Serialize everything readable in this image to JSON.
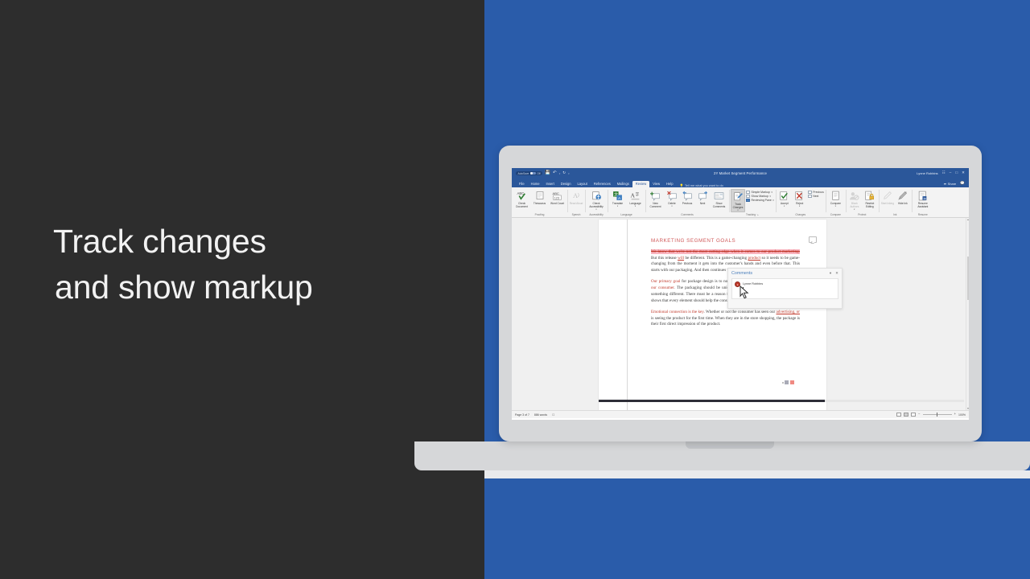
{
  "headline": {
    "line1": "Track changes",
    "line2": "and show markup"
  },
  "colors": {
    "background_left": "#2d2d2d",
    "background_right": "#2a5caa",
    "word_accent": "#2b579a",
    "heading_red": "#d05a5a",
    "markup_red": "#c0392b",
    "deletion_highlight": "#f9b5c0"
  },
  "word": {
    "titlebar": {
      "autosave_label": "AutoSave",
      "autosave_state": "Off",
      "save_icon": "save-icon",
      "undo_icon": "undo-icon",
      "redo_icon": "redo-icon",
      "customize_icon": "customize-quick-access-icon",
      "document_title": "2Y Market Segment Performance",
      "user_name": "Lynne Robbins",
      "ribbon_display_icon": "ribbon-display-options-icon",
      "minimize": "–",
      "maximize": "□",
      "close": "✕"
    },
    "tabs": [
      {
        "label": "File",
        "active": false
      },
      {
        "label": "Home",
        "active": false
      },
      {
        "label": "Insert",
        "active": false
      },
      {
        "label": "Design",
        "active": false
      },
      {
        "label": "Layout",
        "active": false
      },
      {
        "label": "References",
        "active": false
      },
      {
        "label": "Mailings",
        "active": false
      },
      {
        "label": "Review",
        "active": true
      },
      {
        "label": "View",
        "active": false
      },
      {
        "label": "Help",
        "active": false
      }
    ],
    "tellme": "Tell me what you want to do",
    "share_label": "Share",
    "comments_button_icon": "comments-icon",
    "ribbon": {
      "groups": [
        {
          "name": "Proofing",
          "buttons": [
            {
              "label": "Check\nDocument",
              "icon": "spell-check-icon",
              "disabled": false,
              "caret": false
            },
            {
              "label": "Thesaurus",
              "icon": "thesaurus-icon",
              "disabled": false,
              "caret": false
            },
            {
              "label": "Word\nCount",
              "icon": "word-count-icon",
              "disabled": false,
              "caret": false
            }
          ]
        },
        {
          "name": "Speech",
          "buttons": [
            {
              "label": "Read\nAloud",
              "icon": "read-aloud-icon",
              "disabled": true,
              "caret": false
            }
          ]
        },
        {
          "name": "Accessibility",
          "buttons": [
            {
              "label": "Check\nAccessibility",
              "icon": "accessibility-icon",
              "disabled": false,
              "caret": true
            }
          ]
        },
        {
          "name": "Language",
          "buttons": [
            {
              "label": "Translate",
              "icon": "translate-icon",
              "disabled": false,
              "caret": true
            },
            {
              "label": "Language",
              "icon": "language-icon",
              "disabled": false,
              "caret": true
            }
          ]
        },
        {
          "name": "Comments",
          "buttons": [
            {
              "label": "New\nComment",
              "icon": "new-comment-icon",
              "disabled": false,
              "caret": false
            },
            {
              "label": "Delete",
              "icon": "delete-comment-icon",
              "disabled": false,
              "caret": true
            },
            {
              "label": "Previous",
              "icon": "previous-comment-icon",
              "disabled": false,
              "caret": false
            },
            {
              "label": "Next",
              "icon": "next-comment-icon",
              "disabled": false,
              "caret": false
            },
            {
              "label": "Show\nComments",
              "icon": "show-comments-icon",
              "disabled": false,
              "caret": false
            }
          ]
        },
        {
          "name": "Tracking",
          "buttons": [
            {
              "label": "Track\nChanges",
              "icon": "track-changes-icon",
              "disabled": false,
              "caret": true,
              "active": true
            }
          ],
          "stack": [
            {
              "label": "Simple Markup",
              "icon": "markup-mode-icon",
              "caret": true
            },
            {
              "label": "Show Markup",
              "icon": "show-markup-icon",
              "caret": true
            },
            {
              "label": "Reviewing Pane",
              "icon": "reviewing-pane-icon",
              "caret": true
            }
          ],
          "dialog_launcher": true
        },
        {
          "name": "Changes",
          "buttons": [
            {
              "label": "Accept",
              "icon": "accept-change-icon",
              "disabled": false,
              "caret": true
            },
            {
              "label": "Reject",
              "icon": "reject-change-icon",
              "disabled": false,
              "caret": true
            }
          ],
          "stack": [
            {
              "label": "Previous",
              "icon": "previous-change-icon",
              "caret": false
            },
            {
              "label": "Next",
              "icon": "next-change-icon",
              "caret": false
            }
          ]
        },
        {
          "name": "Compare",
          "buttons": [
            {
              "label": "Compare",
              "icon": "compare-icon",
              "disabled": false,
              "caret": true
            }
          ]
        },
        {
          "name": "Protect",
          "buttons": [
            {
              "label": "Block\nAuthors",
              "icon": "block-authors-icon",
              "disabled": true,
              "caret": true
            },
            {
              "label": "Restrict\nEditing",
              "icon": "restrict-editing-icon",
              "disabled": false,
              "caret": false
            }
          ]
        },
        {
          "name": "Ink",
          "buttons": [
            {
              "label": "Start\nInking",
              "icon": "start-inking-icon",
              "disabled": true,
              "caret": false
            },
            {
              "label": "Hide\nInk",
              "icon": "hide-ink-icon",
              "disabled": false,
              "caret": false
            }
          ]
        },
        {
          "name": "Resume",
          "buttons": [
            {
              "label": "Resume\nAssistant",
              "icon": "resume-assistant-icon",
              "disabled": false,
              "caret": false
            }
          ]
        }
      ]
    },
    "document": {
      "heading": "MARKETING SEGMENT GOALS",
      "paragraphs": [
        {
          "runs": [
            {
              "text": "We know that we're not the most cutting-edge when it comes to our product marketing.",
              "style": "deleted"
            },
            {
              "text": " But this release ",
              "style": "normal"
            },
            {
              "text": "will",
              "style": "inserted"
            },
            {
              "text": " be different. This is a game-changing ",
              "style": "normal"
            },
            {
              "text": "product",
              "style": "inserted"
            },
            {
              "text": " so it needs to be game-changing from the moment it gets into the customer's hands and even before that. This starts with our packaging. And then continues with our marketing strategy.",
              "style": "normal"
            }
          ]
        },
        {
          "runs": [
            {
              "text": "Our primary goal",
              "style": "red"
            },
            {
              "text": " for package design is to not just showcase a product but ",
              "style": "normal"
            },
            {
              "text": "connect with our consumer",
              "style": "red"
            },
            {
              "text": ". The packaging should be unique and creative and not simply to create something different. There must be a reason for this packaging—our marketing research shows that every element should help the consumer connect with the product in some way.",
              "style": "normal"
            }
          ]
        },
        {
          "runs": [
            {
              "text": "Emotional connection is the key",
              "style": "red"
            },
            {
              "text": ". Whether or not the consumer has seen our ",
              "style": "normal"
            },
            {
              "text": "advertising, or",
              "style": "inserted"
            },
            {
              "text": " is seeing the product for the first time. When they are in the store shopping, the package is their first direct impression of the product.",
              "style": "normal"
            }
          ]
        }
      ]
    },
    "comments_pane": {
      "title": "Comments",
      "minimize_icon": "minimize-pane-icon",
      "close_icon": "close-pane-icon",
      "comment": {
        "author": "Lynne Robbins",
        "avatar_initial": "LR",
        "body": ""
      }
    },
    "statusbar": {
      "page": "Page 3 of 7",
      "words": "886 words",
      "proofing_icon": "proofing-status-icon",
      "views": [
        {
          "name": "read-mode-view",
          "selected": false
        },
        {
          "name": "print-layout-view",
          "selected": true
        },
        {
          "name": "web-layout-view",
          "selected": false
        }
      ],
      "zoom_out": "−",
      "zoom_in": "+",
      "zoom_value": "100%"
    }
  }
}
